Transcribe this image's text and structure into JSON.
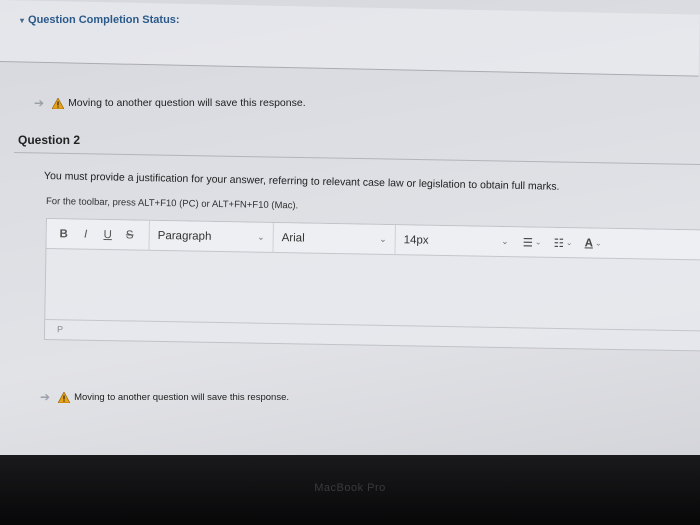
{
  "status": {
    "label": "Question Completion Status:"
  },
  "notice_top": {
    "text": "Moving to another question will save this response."
  },
  "question": {
    "title": "Question 2",
    "text": "You must provide a justification for your answer, referring to relevant case law or legislation to obtain full marks.",
    "toolbar_hint": "For the toolbar, press ALT+F10 (PC) or ALT+FN+F10 (Mac)."
  },
  "editor": {
    "bold": "B",
    "italic": "I",
    "underline": "U",
    "strike": "S",
    "paragraph": "Paragraph",
    "font": "Arial",
    "size": "14px",
    "path": "P",
    "bullet_list_icon": "bullet-list-icon",
    "numbered_list_icon": "numbered-list-icon",
    "text_color_label": "A"
  },
  "notice_bottom": {
    "text": "Moving to another question will save this response."
  },
  "device": {
    "brand": "MacBook Pro"
  }
}
